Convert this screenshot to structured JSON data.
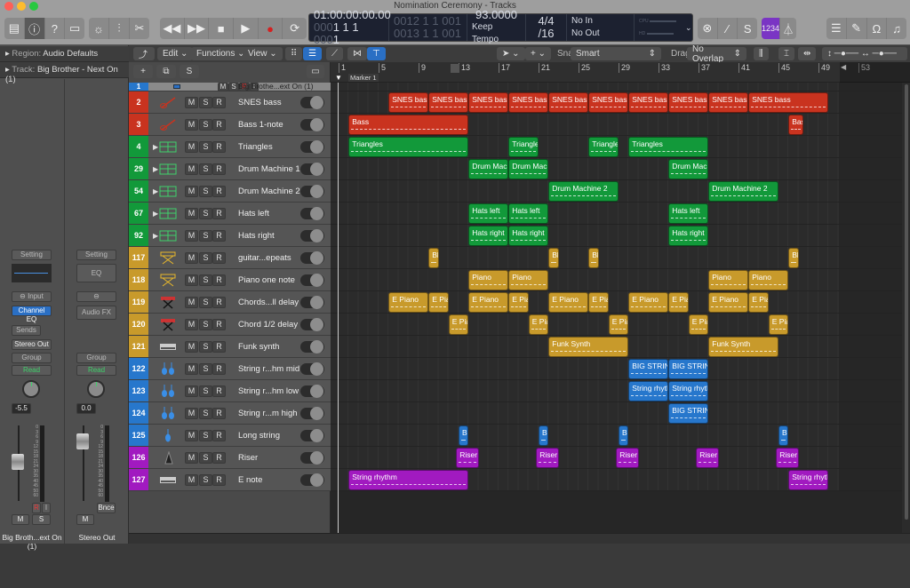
{
  "window": {
    "title": "Nomination Ceremony - Tracks",
    "lights": [
      "#fe5f57",
      "#febc2e",
      "#28c840"
    ]
  },
  "toolbar": {
    "left_group": [
      {
        "icon": "library-icon",
        "glyph": "▤"
      },
      {
        "icon": "inspector-icon",
        "glyph": "ⓘ",
        "active": true
      },
      {
        "icon": "quick-help-icon",
        "glyph": "?"
      },
      {
        "icon": "toolbar-icon",
        "glyph": "▭"
      }
    ],
    "mid_group": [
      {
        "icon": "smart-controls-icon",
        "glyph": "☼"
      },
      {
        "icon": "mixer-icon",
        "glyph": "⫶"
      },
      {
        "icon": "editors-scissors-icon",
        "glyph": "✂"
      }
    ],
    "transport": [
      {
        "icon": "rewind-icon",
        "glyph": "◀◀"
      },
      {
        "icon": "fast-forward-icon",
        "glyph": "▶▶"
      },
      {
        "icon": "stop-icon",
        "glyph": "■"
      },
      {
        "icon": "play-icon",
        "glyph": "▶"
      },
      {
        "icon": "record-icon",
        "glyph": "●",
        "color": "#d42020"
      },
      {
        "icon": "cycle-icon",
        "glyph": "⟳"
      }
    ],
    "right_group1": [
      {
        "icon": "replace-icon",
        "glyph": "⊗"
      },
      {
        "icon": "tuner-icon",
        "glyph": "⁄"
      },
      {
        "icon": "solo-icon",
        "glyph": "S"
      }
    ],
    "count_in": "1234",
    "count_in_color": "#7a35c4",
    "right_group2": [
      {
        "icon": "list-editors-icon",
        "glyph": "☰"
      },
      {
        "icon": "note-pad-icon",
        "glyph": "✎"
      },
      {
        "icon": "loop-browser-icon",
        "glyph": "Ω"
      },
      {
        "icon": "browser-icon",
        "glyph": "♫"
      }
    ]
  },
  "lcd": {
    "smpte": "01:00:00:00.00",
    "position_dim": "000",
    "position": "1  1  1",
    "position_tick_dim": "00",
    "position_tick": "1",
    "cycle_start_dim": "00",
    "cycle_start": "12  1  1",
    "cycle_start_tick": "001",
    "cycle_end_dim": "00",
    "cycle_end": "13  1  1",
    "cycle_end_tick": "001",
    "tempo": "93.0000",
    "tempo_mode": "Keep Tempo",
    "signature": "4/4",
    "division": "/16",
    "midi_in": "No In",
    "midi_out": "No Out",
    "cpu_label": "CPU",
    "hd_label": "HD"
  },
  "edit_toolbar": {
    "edit": "Edit",
    "functions": "Functions",
    "view": "View",
    "snap_label": "Snap:",
    "snap_value": "Smart",
    "drag_label": "Drag:",
    "drag_value": "No Overlap",
    "accent": "#2a6fc4"
  },
  "tracklist_header": {
    "add": "+",
    "duplicate": "⧉",
    "solo": "S"
  },
  "inspector": {
    "region_key": "Region:",
    "region_value": "Audio Defaults",
    "track_key": "Track:",
    "track_value": "Big Brother - Next On (1)",
    "strips": [
      {
        "setting": "Setting",
        "input": "Input",
        "plugin": "Channel EQ",
        "sends": "Sends",
        "output": "Stereo Out",
        "group": "Group",
        "automation": "Read",
        "pan": "-5.5",
        "record": "R",
        "input_mon": "I",
        "mute": "M",
        "solo": "S",
        "name": "Big Broth...ext On (1)"
      },
      {
        "setting": "Setting",
        "eq": "EQ",
        "plugin": "Audio FX",
        "group": "Group",
        "automation": "Read",
        "pan": "0.0",
        "bounce": "Bnce",
        "mute": "M",
        "name": "Stereo Out"
      }
    ],
    "meter_scale": [
      "0",
      "3",
      "6",
      "9",
      "12",
      "15",
      "18",
      "21",
      "24",
      "30",
      "35",
      "40",
      "45",
      "50",
      "60"
    ]
  },
  "ruler": {
    "bars": [
      "1",
      "5",
      "9",
      "13",
      "17",
      "21",
      "25",
      "29",
      "33",
      "37",
      "41",
      "45",
      "49",
      "53"
    ],
    "marker": "Marker 1"
  },
  "colors": {
    "red": "#c9331f",
    "green": "#12993a",
    "yellow": "#c89a2b",
    "blue": "#2777cc",
    "purple": "#a11ac0"
  },
  "tracks": [
    {
      "num": "1",
      "name": "Big Brothe...ext On (1)",
      "color": "blue",
      "icon": "audio-track-icon",
      "main": true,
      "regions": []
    },
    {
      "num": "2",
      "name": "SNES bass",
      "color": "red",
      "icon": "bass-guitar-icon",
      "regions": [
        {
          "start": 6,
          "length": 4,
          "label": "SNES bass"
        },
        {
          "start": 10,
          "length": 4,
          "label": "SNES bass"
        },
        {
          "start": 14,
          "length": 4,
          "label": "SNES bass"
        },
        {
          "start": 18,
          "length": 4,
          "label": "SNES bass"
        },
        {
          "start": 22,
          "length": 4,
          "label": "SNES bass"
        },
        {
          "start": 26,
          "length": 4,
          "label": "SNES bass"
        },
        {
          "start": 30,
          "length": 4,
          "label": "SNES bass"
        },
        {
          "start": 34,
          "length": 4,
          "label": "SNES bass"
        },
        {
          "start": 38,
          "length": 4,
          "label": "SNES bass"
        },
        {
          "start": 42,
          "length": 8,
          "label": "SNES bass"
        }
      ]
    },
    {
      "num": "3",
      "name": "Bass 1-note",
      "color": "red",
      "icon": "bass-guitar-icon",
      "regions": [
        {
          "start": 2,
          "length": 12,
          "label": "Bass"
        },
        {
          "start": 46,
          "length": 1.5,
          "label": "Bas"
        }
      ]
    },
    {
      "num": "4",
      "name": "Triangles",
      "color": "green",
      "icon": "drum-machine-icon",
      "stack": true,
      "regions": [
        {
          "start": 2,
          "length": 12,
          "label": "Triangles"
        },
        {
          "start": 18,
          "length": 3,
          "label": "Triangles"
        },
        {
          "start": 26,
          "length": 3,
          "label": "Triangles"
        },
        {
          "start": 30,
          "length": 8,
          "label": "Triangles"
        }
      ]
    },
    {
      "num": "29",
      "name": "Drum Machine 1",
      "color": "green",
      "icon": "drum-machine-icon",
      "stack": true,
      "regions": [
        {
          "start": 14,
          "length": 4,
          "label": "Drum Machi"
        },
        {
          "start": 18,
          "length": 4,
          "label": "Drum Machi"
        },
        {
          "start": 34,
          "length": 4,
          "label": "Drum Machi"
        }
      ]
    },
    {
      "num": "54",
      "name": "Drum Machine 2",
      "color": "green",
      "icon": "drum-machine-icon",
      "stack": true,
      "regions": [
        {
          "start": 22,
          "length": 7,
          "label": "Drum Machine 2"
        },
        {
          "start": 38,
          "length": 7,
          "label": "Drum Machine 2"
        }
      ]
    },
    {
      "num": "67",
      "name": "Hats left",
      "color": "green",
      "icon": "drum-machine-icon",
      "stack": true,
      "regions": [
        {
          "start": 14,
          "length": 4,
          "label": "Hats left"
        },
        {
          "start": 18,
          "length": 4,
          "label": "Hats left"
        },
        {
          "start": 34,
          "length": 4,
          "label": "Hats left"
        }
      ]
    },
    {
      "num": "92",
      "name": "Hats right",
      "color": "green",
      "icon": "drum-machine-icon",
      "stack": true,
      "regions": [
        {
          "start": 14,
          "length": 4,
          "label": "Hats right"
        },
        {
          "start": 18,
          "length": 4,
          "label": "Hats right"
        },
        {
          "start": 34,
          "length": 4,
          "label": "Hats right"
        }
      ]
    },
    {
      "num": "117",
      "name": "guitar...epeats",
      "color": "yellow",
      "icon": "keyboard-stand-icon",
      "regions": [
        {
          "start": 10,
          "length": 1,
          "label": "Bl"
        },
        {
          "start": 22,
          "length": 1,
          "label": "Bl"
        },
        {
          "start": 26,
          "length": 1,
          "label": "Bl"
        },
        {
          "start": 46,
          "length": 1,
          "label": "Bl"
        }
      ]
    },
    {
      "num": "118",
      "name": "Piano one note",
      "color": "yellow",
      "icon": "keyboard-stand-icon",
      "regions": [
        {
          "start": 14,
          "length": 4,
          "label": "Piano"
        },
        {
          "start": 18,
          "length": 4,
          "label": "Piano"
        },
        {
          "start": 38,
          "length": 4,
          "label": "Piano"
        },
        {
          "start": 42,
          "length": 4,
          "label": "Piano"
        }
      ]
    },
    {
      "num": "119",
      "name": "Chords...ll delay",
      "color": "yellow",
      "icon": "red-keyboard-icon",
      "regions": [
        {
          "start": 6,
          "length": 4,
          "label": "E Piano"
        },
        {
          "start": 10,
          "length": 2,
          "label": "E Pia"
        },
        {
          "start": 14,
          "length": 4,
          "label": "E Piano"
        },
        {
          "start": 18,
          "length": 2,
          "label": "E Pia"
        },
        {
          "start": 22,
          "length": 4,
          "label": "E Piano"
        },
        {
          "start": 26,
          "length": 2,
          "label": "E Pia"
        },
        {
          "start": 30,
          "length": 4,
          "label": "E Piano"
        },
        {
          "start": 34,
          "length": 2,
          "label": "E Pia"
        },
        {
          "start": 38,
          "length": 4,
          "label": "E Piano"
        },
        {
          "start": 42,
          "length": 2,
          "label": "E Pia"
        }
      ]
    },
    {
      "num": "120",
      "name": "Chord 1/2 delay",
      "color": "yellow",
      "icon": "red-keyboard-icon",
      "regions": [
        {
          "start": 12,
          "length": 2,
          "label": "E Pia"
        },
        {
          "start": 20,
          "length": 2,
          "label": "E Pia"
        },
        {
          "start": 28,
          "length": 2,
          "label": "E Pia"
        },
        {
          "start": 36,
          "length": 2,
          "label": "E Pia"
        },
        {
          "start": 44,
          "length": 2,
          "label": "E Pia"
        }
      ]
    },
    {
      "num": "121",
      "name": "Funk synth",
      "color": "yellow",
      "icon": "synth-icon",
      "regions": [
        {
          "start": 22,
          "length": 8,
          "label": "Funk Synth"
        },
        {
          "start": 38,
          "length": 7,
          "label": "Funk Synth"
        }
      ]
    },
    {
      "num": "122",
      "name": "String r...hm mid",
      "color": "blue",
      "icon": "strings-icon",
      "regions": [
        {
          "start": 30,
          "length": 4,
          "label": "BIG STRING"
        },
        {
          "start": 34,
          "length": 4,
          "label": "BIG STRING"
        }
      ]
    },
    {
      "num": "123",
      "name": "String r...hm low",
      "color": "blue",
      "icon": "strings-icon",
      "regions": [
        {
          "start": 30,
          "length": 4,
          "label": "String rhyth"
        },
        {
          "start": 34,
          "length": 4,
          "label": "String rhyth"
        }
      ]
    },
    {
      "num": "124",
      "name": "String r...m high",
      "color": "blue",
      "icon": "strings-icon",
      "regions": [
        {
          "start": 34,
          "length": 4,
          "label": "BIG STRING"
        }
      ]
    },
    {
      "num": "125",
      "name": "Long string",
      "color": "blue",
      "icon": "violin-icon",
      "regions": [
        {
          "start": 13,
          "length": 1,
          "label": "Bl"
        },
        {
          "start": 21,
          "length": 1,
          "label": "Bl"
        },
        {
          "start": 29,
          "length": 1,
          "label": "Bl"
        },
        {
          "start": 45,
          "length": 1,
          "label": "Bl"
        }
      ]
    },
    {
      "num": "126",
      "name": "Riser",
      "color": "purple",
      "icon": "riser-icon",
      "regions": [
        {
          "start": 12.75,
          "length": 2.25,
          "label": "Riser"
        },
        {
          "start": 20.75,
          "length": 2.25,
          "label": "Riser"
        },
        {
          "start": 28.75,
          "length": 2.25,
          "label": "Riser"
        },
        {
          "start": 36.75,
          "length": 2.25,
          "label": "Riser"
        },
        {
          "start": 44.75,
          "length": 2.25,
          "label": "Riser"
        }
      ]
    },
    {
      "num": "127",
      "name": "E note",
      "color": "purple",
      "icon": "synth-icon",
      "regions": [
        {
          "start": 2,
          "length": 12,
          "label": "String rhythm"
        },
        {
          "start": 46,
          "length": 4,
          "label": "String rhyth"
        }
      ]
    }
  ]
}
